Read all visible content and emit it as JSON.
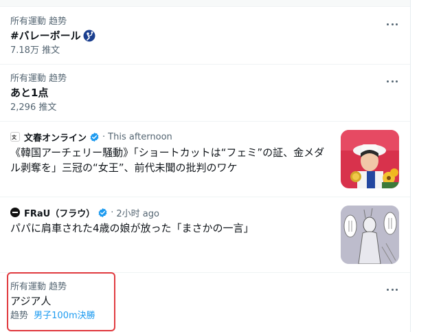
{
  "trends": [
    {
      "meta": "所有運動 趋势",
      "title": "#バレーボール",
      "count": "7.18万 推文"
    },
    {
      "meta": "所有運動 趋势",
      "title": "あと1点",
      "count": "2,296 推文"
    }
  ],
  "news": [
    {
      "source": "文春オンライン",
      "time": "This afternoon",
      "headline": "《韓国アーチェリー騒動》「ショートカットは“フェミ”の証、金メダル剥奪を」三冠の“女王”、前代未聞の批判のワケ",
      "thumb_icon": "archer-photo-icon"
    },
    {
      "source": "FRaU（フラウ）",
      "time": "2小时 ago",
      "headline": "パパに肩車された4歳の娘が放った「まさかの一言」",
      "thumb_icon": "manga-panel-icon"
    }
  ],
  "last_trend": {
    "meta": "所有運動 趋势",
    "title": "アジア人",
    "sub_prefix": "趋势",
    "sub_link": "男子100m決勝"
  },
  "separator": "·",
  "colors": {
    "accent": "#1d9bf0",
    "highlight": "#e0393e",
    "muted": "#536471"
  }
}
